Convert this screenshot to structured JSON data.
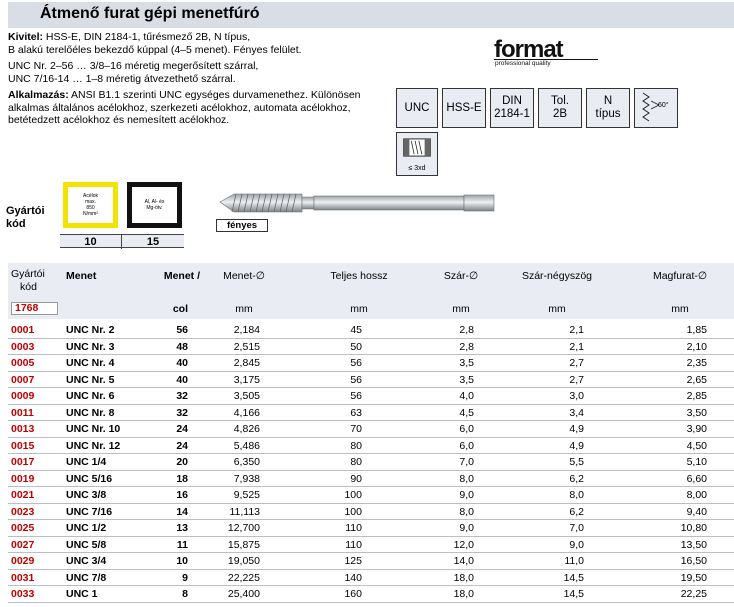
{
  "header": {
    "title": "Átmenő furat gépi menetfúró"
  },
  "description": {
    "kivitel_label": "Kivitel:",
    "kivitel_text": " HSS-E, DIN 2184-1, tűrésmező 2B, N típus,",
    "kivitel_line2": "B alakú terelőéles bekezdő kúppal (4–5 menet). Fényes felület.",
    "unc_line1": "UNC Nr. 2–56 … 3/8–16 méretig megerősített szárral,",
    "unc_line2": "UNC 7/16-14 … 1–8 méretig átvezethető szárral.",
    "alk_label": "Alkalmazás:",
    "alk_text": " ANSI B1.1 szerinti UNC egységes durvamenethez. Különösen",
    "alk_line2": "alkalmas általános acélokhoz, szerkezeti acélokhoz, automata acélokhoz,",
    "alk_line3": "betétedzett acélokhoz és nemesített acélokhoz."
  },
  "logo": {
    "word": "format",
    "tagline": "professional quality"
  },
  "properties": {
    "unc": "UNC",
    "hss": "HSS-E",
    "din1": "DIN",
    "din2": "2184-1",
    "tol1": "Tol.",
    "tol2": "2B",
    "n1": "N",
    "n2": "típus",
    "angle": "60°",
    "depth": "≤ 3xd"
  },
  "manufacturer": {
    "label1": "Gyártói",
    "label2": "kód",
    "box1_lines": [
      "Acélok",
      "max.",
      "850",
      "N/mm²"
    ],
    "box2_lines": [
      "Al, Al- és",
      "Mg-ötv."
    ],
    "code1": "10",
    "code2": "15",
    "accent_yellow": "#f2e300"
  },
  "tool": {
    "finish_label": "fényes"
  },
  "table": {
    "headers": {
      "code1": "Gyártói",
      "code2": "kód",
      "code_value": "1768",
      "menet": "Menet",
      "col1": "Menet /",
      "col2": "col",
      "diameter": "Menet-∅",
      "length": "Teljes hossz",
      "shank": "Szár-∅",
      "square": "Szár-négyszög",
      "core": "Magfurat-∅",
      "mm": "mm"
    },
    "rows": [
      {
        "code": "0001",
        "menet": "UNC Nr.  2",
        "col": "56",
        "d": "2,184",
        "len": "45",
        "shank": "2,8",
        "sq": "2,1",
        "core": "1,85"
      },
      {
        "code": "0003",
        "menet": "UNC Nr.  3",
        "col": "48",
        "d": "2,515",
        "len": "50",
        "shank": "2,8",
        "sq": "2,1",
        "core": "2,10"
      },
      {
        "code": "0005",
        "menet": "UNC Nr.  4",
        "col": "40",
        "d": "2,845",
        "len": "56",
        "shank": "3,5",
        "sq": "2,7",
        "core": "2,35"
      },
      {
        "code": "0007",
        "menet": "UNC Nr.  5",
        "col": "40",
        "d": "3,175",
        "len": "56",
        "shank": "3,5",
        "sq": "2,7",
        "core": "2,65"
      },
      {
        "code": "0009",
        "menet": "UNC Nr.  6",
        "col": "32",
        "d": "3,505",
        "len": "56",
        "shank": "4,0",
        "sq": "3,0",
        "core": "2,85"
      },
      {
        "code": "0011",
        "menet": "UNC Nr.  8",
        "col": "32",
        "d": "4,166",
        "len": "63",
        "shank": "4,5",
        "sq": "3,4",
        "core": "3,50"
      },
      {
        "code": "0013",
        "menet": "UNC Nr. 10",
        "col": "24",
        "d": "4,826",
        "len": "70",
        "shank": "6,0",
        "sq": "4,9",
        "core": "3,90"
      },
      {
        "code": "0015",
        "menet": "UNC Nr. 12",
        "col": "24",
        "d": "5,486",
        "len": "80",
        "shank": "6,0",
        "sq": "4,9",
        "core": "4,50"
      },
      {
        "code": "0017",
        "menet": "UNC 1/4",
        "col": "20",
        "d": "6,350",
        "len": "80",
        "shank": "7,0",
        "sq": "5,5",
        "core": "5,10"
      },
      {
        "code": "0019",
        "menet": "UNC 5/16",
        "col": "18",
        "d": "7,938",
        "len": "90",
        "shank": "8,0",
        "sq": "6,2",
        "core": "6,60"
      },
      {
        "code": "0021",
        "menet": "UNC 3/8",
        "col": "16",
        "d": "9,525",
        "len": "100",
        "shank": "9,0",
        "sq": "8,0",
        "core": "8,00"
      },
      {
        "code": "0023",
        "menet": "UNC 7/16",
        "col": "14",
        "d": "11,113",
        "len": "100",
        "shank": "8,0",
        "sq": "6,2",
        "core": "9,40"
      },
      {
        "code": "0025",
        "menet": "UNC 1/2",
        "col": "13",
        "d": "12,700",
        "len": "110",
        "shank": "9,0",
        "sq": "7,0",
        "core": "10,80"
      },
      {
        "code": "0027",
        "menet": "UNC 5/8",
        "col": "11",
        "d": "15,875",
        "len": "110",
        "shank": "12,0",
        "sq": "9,0",
        "core": "13,50"
      },
      {
        "code": "0029",
        "menet": "UNC 3/4",
        "col": "10",
        "d": "19,050",
        "len": "125",
        "shank": "14,0",
        "sq": "11,0",
        "core": "16,50"
      },
      {
        "code": "0031",
        "menet": "UNC 7/8",
        "col": "9",
        "d": "22,225",
        "len": "140",
        "shank": "18,0",
        "sq": "14,5",
        "core": "19,50"
      },
      {
        "code": "0033",
        "menet": "UNC 1",
        "col": "8",
        "d": "25,400",
        "len": "160",
        "shank": "18,0",
        "sq": "14,5",
        "core": "22,25"
      }
    ]
  }
}
